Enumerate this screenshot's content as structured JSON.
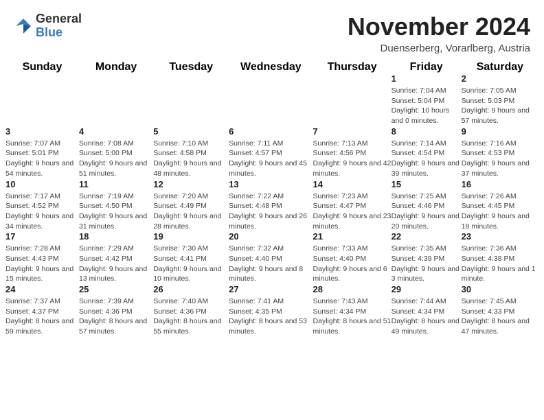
{
  "header": {
    "logo_general": "General",
    "logo_blue": "Blue",
    "month": "November 2024",
    "location": "Duenserberg, Vorarlberg, Austria"
  },
  "weekdays": [
    "Sunday",
    "Monday",
    "Tuesday",
    "Wednesday",
    "Thursday",
    "Friday",
    "Saturday"
  ],
  "weeks": [
    [
      {
        "day": "",
        "info": ""
      },
      {
        "day": "",
        "info": ""
      },
      {
        "day": "",
        "info": ""
      },
      {
        "day": "",
        "info": ""
      },
      {
        "day": "",
        "info": ""
      },
      {
        "day": "1",
        "info": "Sunrise: 7:04 AM\nSunset: 5:04 PM\nDaylight: 10 hours and 0 minutes."
      },
      {
        "day": "2",
        "info": "Sunrise: 7:05 AM\nSunset: 5:03 PM\nDaylight: 9 hours and 57 minutes."
      }
    ],
    [
      {
        "day": "3",
        "info": "Sunrise: 7:07 AM\nSunset: 5:01 PM\nDaylight: 9 hours and 54 minutes."
      },
      {
        "day": "4",
        "info": "Sunrise: 7:08 AM\nSunset: 5:00 PM\nDaylight: 9 hours and 51 minutes."
      },
      {
        "day": "5",
        "info": "Sunrise: 7:10 AM\nSunset: 4:58 PM\nDaylight: 9 hours and 48 minutes."
      },
      {
        "day": "6",
        "info": "Sunrise: 7:11 AM\nSunset: 4:57 PM\nDaylight: 9 hours and 45 minutes."
      },
      {
        "day": "7",
        "info": "Sunrise: 7:13 AM\nSunset: 4:56 PM\nDaylight: 9 hours and 42 minutes."
      },
      {
        "day": "8",
        "info": "Sunrise: 7:14 AM\nSunset: 4:54 PM\nDaylight: 9 hours and 39 minutes."
      },
      {
        "day": "9",
        "info": "Sunrise: 7:16 AM\nSunset: 4:53 PM\nDaylight: 9 hours and 37 minutes."
      }
    ],
    [
      {
        "day": "10",
        "info": "Sunrise: 7:17 AM\nSunset: 4:52 PM\nDaylight: 9 hours and 34 minutes."
      },
      {
        "day": "11",
        "info": "Sunrise: 7:19 AM\nSunset: 4:50 PM\nDaylight: 9 hours and 31 minutes."
      },
      {
        "day": "12",
        "info": "Sunrise: 7:20 AM\nSunset: 4:49 PM\nDaylight: 9 hours and 28 minutes."
      },
      {
        "day": "13",
        "info": "Sunrise: 7:22 AM\nSunset: 4:48 PM\nDaylight: 9 hours and 26 minutes."
      },
      {
        "day": "14",
        "info": "Sunrise: 7:23 AM\nSunset: 4:47 PM\nDaylight: 9 hours and 23 minutes."
      },
      {
        "day": "15",
        "info": "Sunrise: 7:25 AM\nSunset: 4:46 PM\nDaylight: 9 hours and 20 minutes."
      },
      {
        "day": "16",
        "info": "Sunrise: 7:26 AM\nSunset: 4:45 PM\nDaylight: 9 hours and 18 minutes."
      }
    ],
    [
      {
        "day": "17",
        "info": "Sunrise: 7:28 AM\nSunset: 4:43 PM\nDaylight: 9 hours and 15 minutes."
      },
      {
        "day": "18",
        "info": "Sunrise: 7:29 AM\nSunset: 4:42 PM\nDaylight: 9 hours and 13 minutes."
      },
      {
        "day": "19",
        "info": "Sunrise: 7:30 AM\nSunset: 4:41 PM\nDaylight: 9 hours and 10 minutes."
      },
      {
        "day": "20",
        "info": "Sunrise: 7:32 AM\nSunset: 4:40 PM\nDaylight: 9 hours and 8 minutes."
      },
      {
        "day": "21",
        "info": "Sunrise: 7:33 AM\nSunset: 4:40 PM\nDaylight: 9 hours and 6 minutes."
      },
      {
        "day": "22",
        "info": "Sunrise: 7:35 AM\nSunset: 4:39 PM\nDaylight: 9 hours and 3 minutes."
      },
      {
        "day": "23",
        "info": "Sunrise: 7:36 AM\nSunset: 4:38 PM\nDaylight: 9 hours and 1 minute."
      }
    ],
    [
      {
        "day": "24",
        "info": "Sunrise: 7:37 AM\nSunset: 4:37 PM\nDaylight: 8 hours and 59 minutes."
      },
      {
        "day": "25",
        "info": "Sunrise: 7:39 AM\nSunset: 4:36 PM\nDaylight: 8 hours and 57 minutes."
      },
      {
        "day": "26",
        "info": "Sunrise: 7:40 AM\nSunset: 4:36 PM\nDaylight: 8 hours and 55 minutes."
      },
      {
        "day": "27",
        "info": "Sunrise: 7:41 AM\nSunset: 4:35 PM\nDaylight: 8 hours and 53 minutes."
      },
      {
        "day": "28",
        "info": "Sunrise: 7:43 AM\nSunset: 4:34 PM\nDaylight: 8 hours and 51 minutes."
      },
      {
        "day": "29",
        "info": "Sunrise: 7:44 AM\nSunset: 4:34 PM\nDaylight: 8 hours and 49 minutes."
      },
      {
        "day": "30",
        "info": "Sunrise: 7:45 AM\nSunset: 4:33 PM\nDaylight: 8 hours and 47 minutes."
      }
    ]
  ]
}
